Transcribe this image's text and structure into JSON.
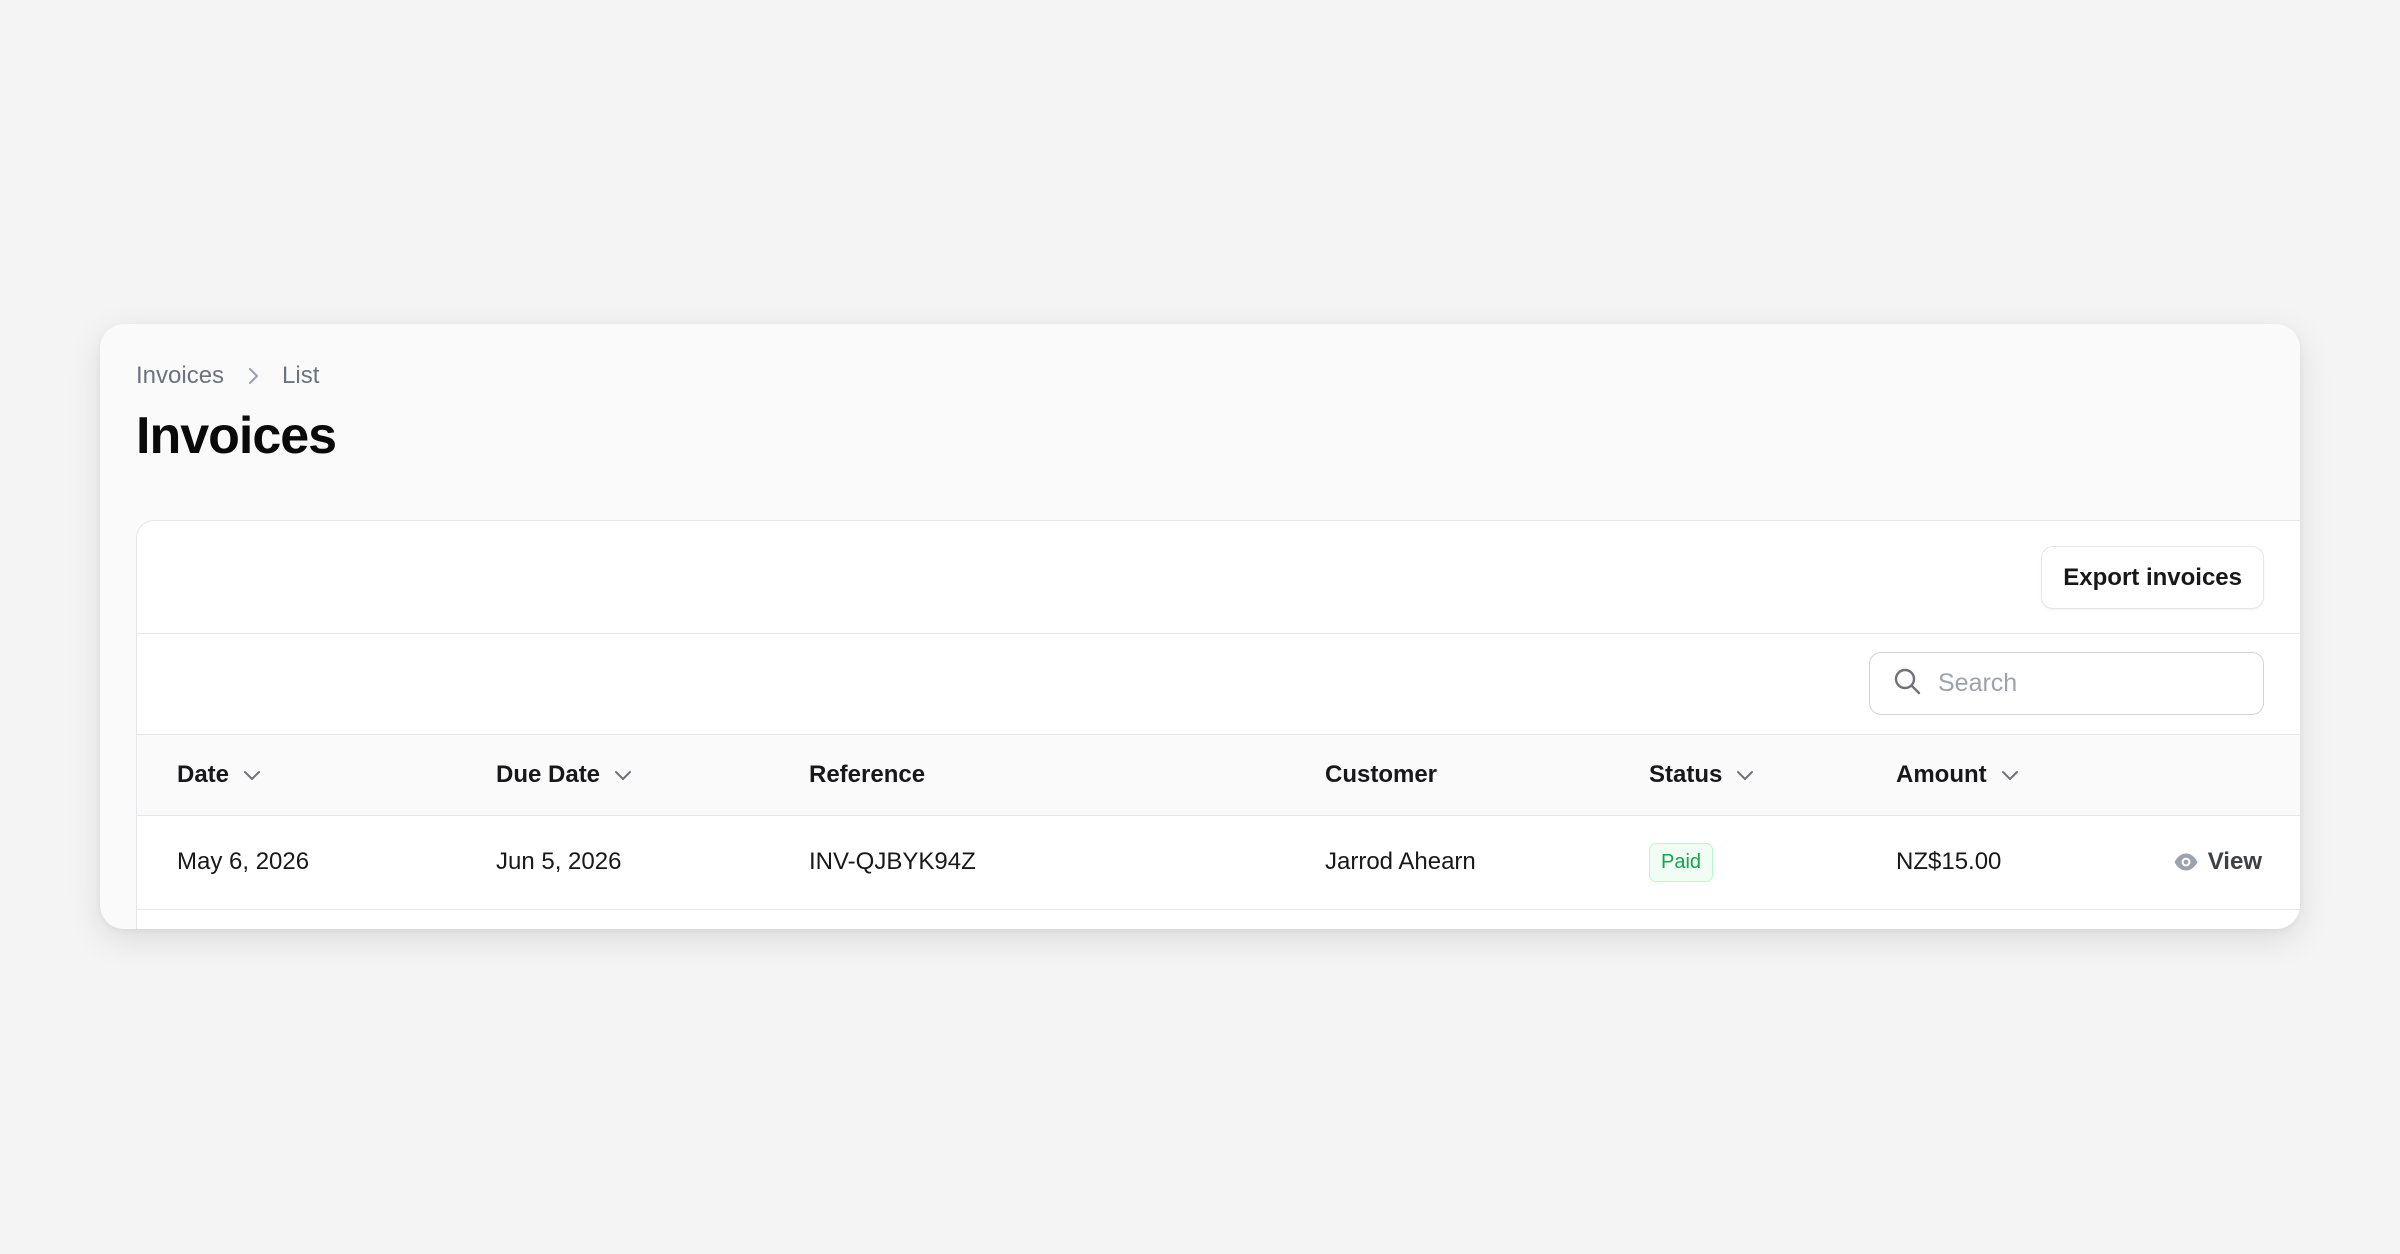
{
  "breadcrumb": {
    "items": [
      "Invoices",
      "List"
    ]
  },
  "page": {
    "title": "Invoices"
  },
  "header": {
    "export_label": "Export invoices"
  },
  "search": {
    "placeholder": "Search",
    "value": ""
  },
  "table": {
    "columns": [
      {
        "label": "Date",
        "sortable": true
      },
      {
        "label": "Due Date",
        "sortable": true
      },
      {
        "label": "Reference",
        "sortable": false
      },
      {
        "label": "Customer",
        "sortable": false
      },
      {
        "label": "Status",
        "sortable": true
      },
      {
        "label": "Amount",
        "sortable": true
      }
    ],
    "rows": [
      {
        "date": "May 6, 2026",
        "due_date": "Jun 5, 2026",
        "reference": "INV-QJBYK94Z",
        "customer": "Jarrod Ahearn",
        "status": "Paid",
        "amount": "NZ$15.00",
        "action": "View"
      }
    ]
  },
  "icons": {
    "breadcrumb_separator": "chevron-right-icon",
    "sort": "chevron-down-icon",
    "search": "search-icon",
    "view": "eye-icon"
  },
  "colors": {
    "status_paid_text": "#16a34a",
    "status_paid_bg": "#f0fdf4",
    "status_paid_border": "#bbf7d0"
  }
}
